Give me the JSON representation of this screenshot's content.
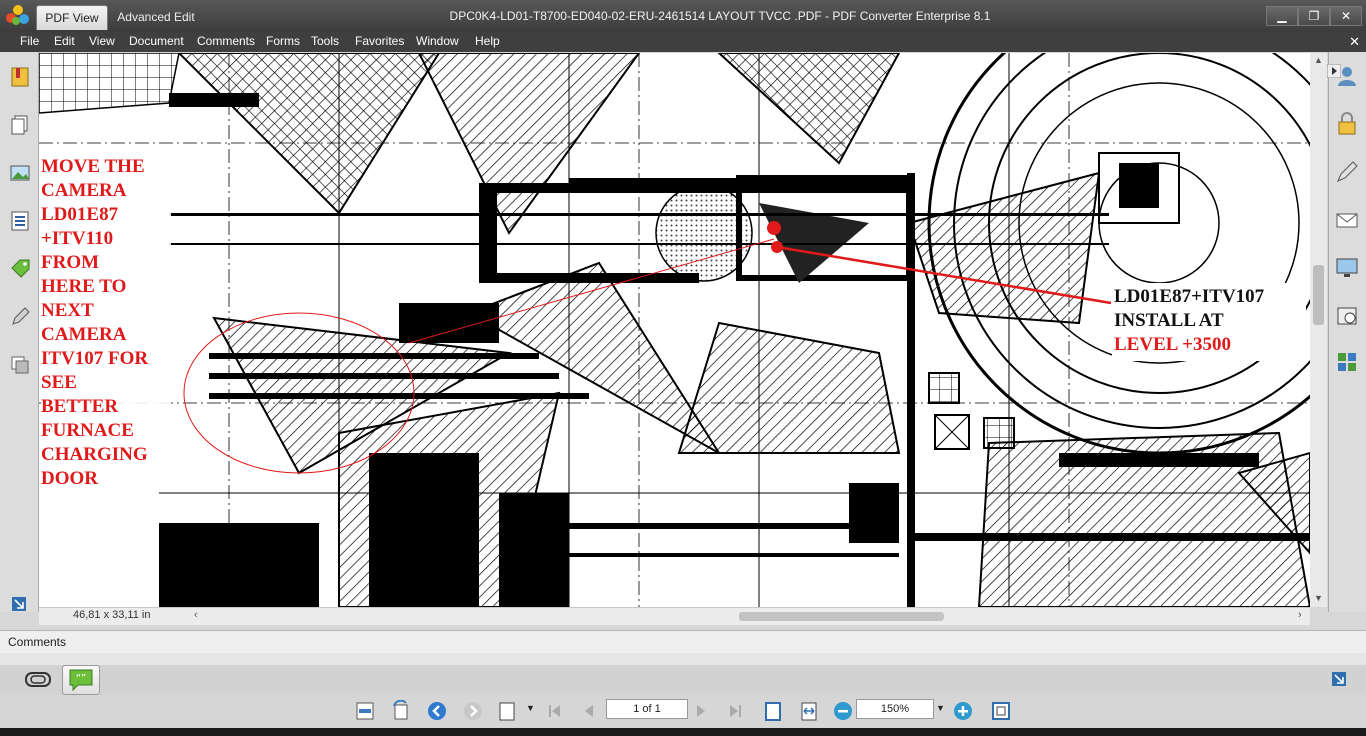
{
  "titlebar": {
    "tabs": [
      "PDF View",
      "Advanced Edit"
    ],
    "window_title": "DPC0K4-LD01-T8700-ED040-02-ERU-2461514 LAYOUT TVCC .PDF - PDF Converter Enterprise 8.1",
    "controls": [
      "minimize",
      "restore",
      "close"
    ]
  },
  "menu": {
    "items": [
      "File",
      "Edit",
      "View",
      "Document",
      "Comments",
      "Forms",
      "Tools",
      "Favorites",
      "Window",
      "Help"
    ]
  },
  "left_panel": {
    "icons": [
      "bookmarks-icon",
      "pages-icon",
      "image-icon",
      "list-icon",
      "tag-icon",
      "edit-tool-icon",
      "layers-icon"
    ]
  },
  "right_panel": {
    "icons": [
      "user-icon",
      "lock-icon",
      "pen-icon",
      "mail-icon",
      "monitor-icon",
      "scan-icon",
      "grid-icon"
    ]
  },
  "document": {
    "annotation_left": [
      "MOVE THE",
      "CAMERA",
      "LD01E87",
      "+ITV110",
      "FROM",
      "HERE TO",
      "NEXT",
      "CAMERA",
      "ITV107 FOR",
      "SEE",
      "BETTER",
      "FURNACE",
      "CHARGING",
      "DOOR"
    ],
    "annotation_right": {
      "line1": "LD01E87+ITV107",
      "line2": "INSTALL AT",
      "line3": "LEVEL +3500"
    },
    "accent_color": "#e01a1a",
    "page_size": "46,81 x 33,11 in"
  },
  "comments": {
    "title": "Comments"
  },
  "navigation": {
    "page_display": "1 of 1",
    "zoom": "150%"
  }
}
